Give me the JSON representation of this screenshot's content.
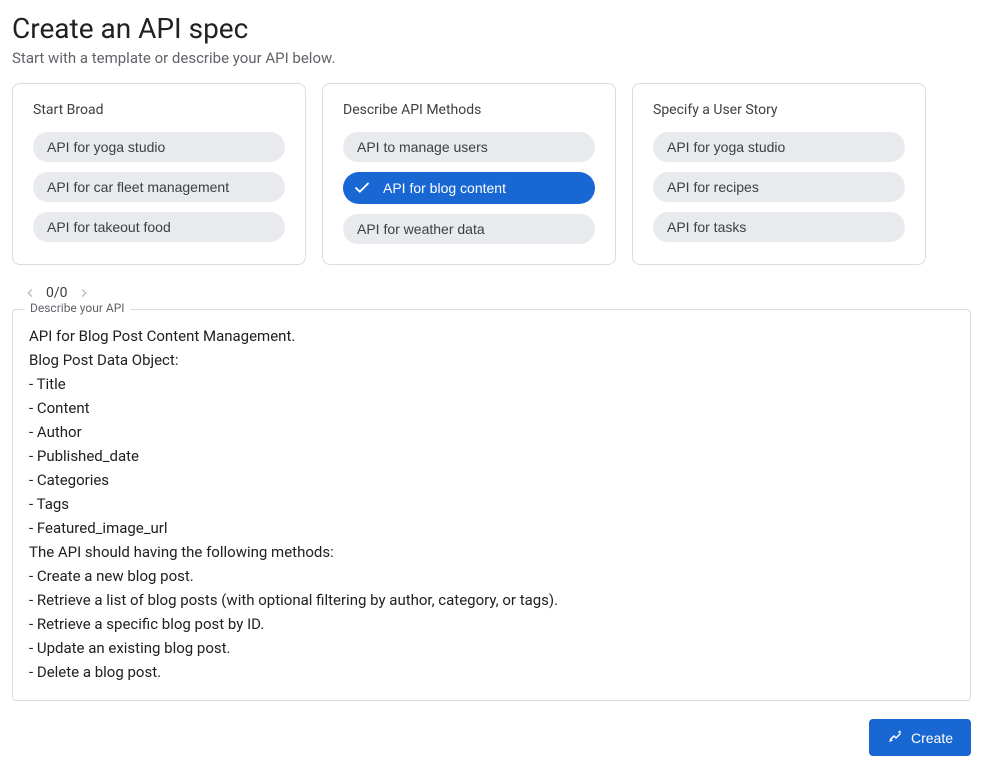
{
  "header": {
    "title": "Create an API spec",
    "subtitle": "Start with a template or describe your API below."
  },
  "cards": [
    {
      "title": "Start Broad",
      "chips": [
        {
          "label": "API for yoga studio",
          "selected": false
        },
        {
          "label": "API for car fleet management",
          "selected": false
        },
        {
          "label": "API for takeout food",
          "selected": false
        }
      ]
    },
    {
      "title": "Describe API Methods",
      "chips": [
        {
          "label": "API to manage users",
          "selected": false
        },
        {
          "label": "API for blog content",
          "selected": true
        },
        {
          "label": "API for weather data",
          "selected": false
        }
      ]
    },
    {
      "title": "Specify a User Story",
      "chips": [
        {
          "label": "API for yoga studio",
          "selected": false
        },
        {
          "label": "API for recipes",
          "selected": false
        },
        {
          "label": "API for tasks",
          "selected": false
        }
      ]
    }
  ],
  "pager": {
    "count": "0/0"
  },
  "describe": {
    "legend": "Describe your API",
    "body": "API for Blog Post Content Management.\nBlog Post Data Object:\n- Title\n- Content\n- Author\n- Published_date\n- Categories\n- Tags\n- Featured_image_url\nThe API should having the following methods:\n- Create a new blog post.\n- Retrieve a list of blog posts (with optional filtering by author, category, or tags).\n- Retrieve a specific blog post by ID.\n- Update an existing blog post.\n- Delete a blog post."
  },
  "footer": {
    "create_label": "Create"
  }
}
